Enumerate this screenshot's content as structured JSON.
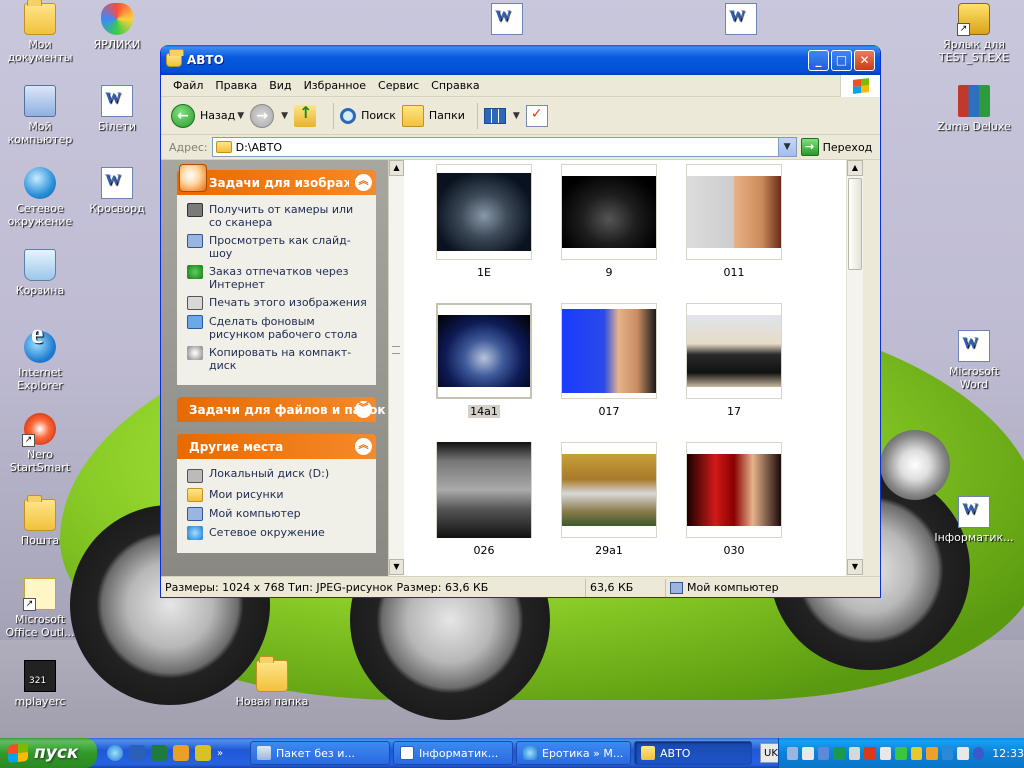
{
  "desktop": {
    "icons_left": [
      {
        "label": "Мои документы",
        "icon": "my-documents-folder-icon"
      },
      {
        "label": "Мой компьютер",
        "icon": "my-computer-icon"
      },
      {
        "label": "Сетевое окружение",
        "icon": "network-places-icon"
      },
      {
        "label": "Корзина",
        "icon": "recycle-bin-icon"
      },
      {
        "label": "Internet Explorer",
        "icon": "internet-explorer-icon"
      },
      {
        "label": "Nero StartSmart",
        "icon": "nero-icon"
      },
      {
        "label": "Пошта",
        "icon": "folder-icon"
      },
      {
        "label": "Microsoft Office Outl...",
        "icon": "outlook-icon"
      },
      {
        "label": "mplayerc",
        "icon": "media-player-icon"
      }
    ],
    "icons_col2": [
      {
        "label": "ЯРЛИКИ",
        "icon": "butterfly-icon"
      },
      {
        "label": "Білети",
        "icon": "word-document-icon"
      },
      {
        "label": "Кросворд",
        "icon": "word-document-icon"
      }
    ],
    "icons_right": [
      {
        "label": "Ярлык для TEST_ST.EXE",
        "icon": "test-app-shortcut-icon"
      },
      {
        "label": "Zuma Deluxe",
        "icon": "zuma-deluxe-icon"
      },
      {
        "label": "Microsoft Word",
        "icon": "word-document-icon"
      },
      {
        "label": "Інформатик...",
        "icon": "word-document-icon"
      }
    ],
    "icons_top": [
      {
        "label": "",
        "icon": "word-document-icon"
      },
      {
        "label": "",
        "icon": "word-document-icon"
      }
    ],
    "icon_bottom": {
      "label": "Новая папка",
      "icon": "new-folder-icon"
    }
  },
  "window": {
    "title": "АВТО",
    "menu": [
      "Файл",
      "Правка",
      "Вид",
      "Избранное",
      "Сервис",
      "Справка"
    ],
    "toolbar": {
      "back_label": "Назад",
      "search_label": "Поиск",
      "folders_label": "Папки"
    },
    "address": {
      "label": "Адрес:",
      "value": "D:\\АВТО",
      "go_label": "Переход"
    },
    "taskpane": {
      "image_tasks": {
        "title": "Задачи для изображений",
        "items": [
          {
            "label": "Получить от камеры или со сканера",
            "icon": "camera-icon"
          },
          {
            "label": "Просмотреть как слайд-шоу",
            "icon": "slideshow-icon"
          },
          {
            "label": "Заказ отпечатков через Интернет",
            "icon": "order-prints-icon"
          },
          {
            "label": "Печать этого изображения",
            "icon": "print-icon"
          },
          {
            "label": "Сделать фоновым рисунком рабочего стола",
            "icon": "wallpaper-icon"
          },
          {
            "label": "Копировать на компакт-диск",
            "icon": "cd-icon"
          }
        ]
      },
      "file_tasks": {
        "title": "Задачи для файлов и папок"
      },
      "other_places": {
        "title": "Другие места",
        "items": [
          {
            "label": "Локальный диск (D:)",
            "icon": "local-disk-icon"
          },
          {
            "label": "Мои рисунки",
            "icon": "my-pictures-icon"
          },
          {
            "label": "Мой компьютер",
            "icon": "my-computer-icon"
          },
          {
            "label": "Сетевое окружение",
            "icon": "network-places-icon"
          }
        ]
      }
    },
    "files": [
      {
        "name": "1E",
        "selected": false
      },
      {
        "name": "9",
        "selected": false
      },
      {
        "name": "011",
        "selected": false
      },
      {
        "name": "14a1",
        "selected": true
      },
      {
        "name": "017",
        "selected": false
      },
      {
        "name": "17",
        "selected": false
      },
      {
        "name": "026",
        "selected": false
      },
      {
        "name": "29a1",
        "selected": false
      },
      {
        "name": "030",
        "selected": false
      }
    ],
    "status": {
      "details": "Размеры: 1024 x 768 Тип: JPEG-рисунок Размер: 63,6 КБ",
      "size": "63,6 КБ",
      "location": "Мой компьютер"
    }
  },
  "taskbar": {
    "start_label": "пуск",
    "tasks": [
      {
        "label": "Пакет без и...",
        "icon": "network-icon",
        "active": false
      },
      {
        "label": "Інформатик...",
        "icon": "word-icon",
        "active": false
      },
      {
        "label": "Еротика » М...",
        "icon": "ie-icon",
        "active": false
      },
      {
        "label": "АВТО",
        "icon": "folder-icon",
        "active": true
      }
    ],
    "language": "UK",
    "quicklaunch_more": "»",
    "clock": "12:33"
  }
}
